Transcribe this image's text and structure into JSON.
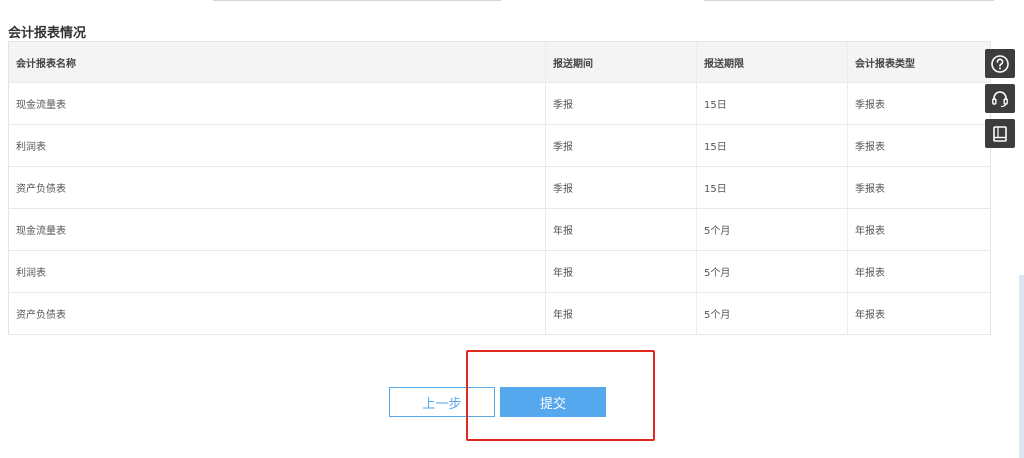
{
  "section": {
    "title": "会计报表情况"
  },
  "table": {
    "headers": [
      "会计报表名称",
      "报送期间",
      "报送期限",
      "会计报表类型"
    ],
    "rows": [
      [
        "现金流量表",
        "季报",
        "15日",
        "季报表"
      ],
      [
        "利润表",
        "季报",
        "15日",
        "季报表"
      ],
      [
        "资产负债表",
        "季报",
        "15日",
        "季报表"
      ],
      [
        "现金流量表",
        "年报",
        "5个月",
        "年报表"
      ],
      [
        "利润表",
        "年报",
        "5个月",
        "年报表"
      ],
      [
        "资产负债表",
        "年报",
        "5个月",
        "年报表"
      ]
    ]
  },
  "side_tools": {
    "icons": [
      "help-icon",
      "customer-service-icon",
      "manual-icon"
    ]
  },
  "actions": {
    "prev_label": "上一步",
    "submit_label": "提交"
  },
  "colors": {
    "accent": "#56a8ee",
    "highlight": "#e0281e",
    "toolbar": "#3d3d3d"
  }
}
